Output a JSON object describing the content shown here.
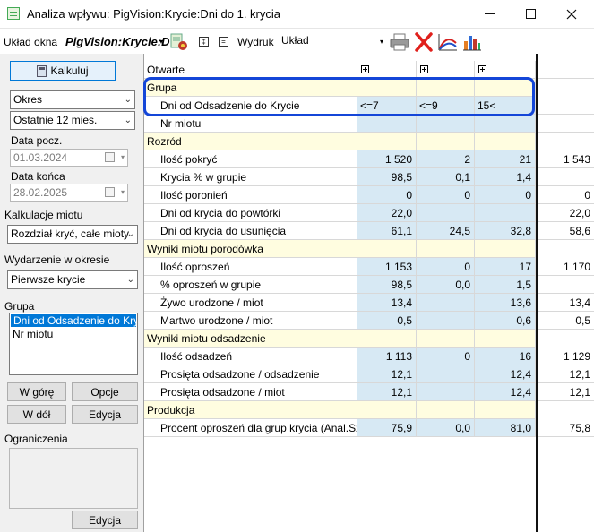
{
  "window": {
    "title": "Analiza wpływu: PigVision:Krycie:Dni do 1. krycia",
    "minimize": "–",
    "maximize": "□",
    "close": "✕"
  },
  "toolbar": {
    "layout_label": "Układ okna",
    "layout_name": "PigVision:Krycie:D",
    "layout_arrow": "▾",
    "expand_symbol": "‡",
    "collapse_symbol": "=",
    "print_label": "Wydruk",
    "print_combo_value": "Układ",
    "combo_arrow": "▾",
    "icons": [
      "layout-gear-icon",
      "printer-icon",
      "delete-x-icon",
      "chart-curve-icon",
      "bar-chart-icon"
    ]
  },
  "left_panel": {
    "calculate_button": "Kalkuluj",
    "period_type": "Okres",
    "period_value": "Ostatnie 12 mies.",
    "start_label": "Data pocz.",
    "start_date": "01.03.2024",
    "end_label": "Data końca",
    "end_date": "28.02.2025",
    "litter_calc_label": "Kalkulacje miotu",
    "litter_calc_value": "Rozdział kryć, całe mioty",
    "event_label": "Wydarzenie w okresie",
    "event_value": "Pierwsze krycie",
    "group_label": "Grupa",
    "group_items": [
      "Dni od Odsadzenie do Krycie",
      "Nr miotu"
    ],
    "btn_up": "W górę",
    "btn_options": "Opcje",
    "btn_down": "W dół",
    "btn_edit": "Edycja",
    "restrictions_label": "Ograniczenia",
    "btn_edit2": "Edycja",
    "arrow": "⌄"
  },
  "grid": {
    "header_label": "Otwarte",
    "header_icon": "expand-column-icon",
    "sections": [
      {
        "title": "Grupa",
        "rows": [
          {
            "label": "Dni od Odsadzenie do Krycie",
            "values": [
              "<=7",
              "<=9",
              "15<",
              ""
            ]
          },
          {
            "label": "Nr miotu",
            "values": [
              "",
              "",
              "",
              ""
            ]
          }
        ]
      },
      {
        "title": "Rozród",
        "rows": [
          {
            "label": "Ilość pokryć",
            "values": [
              "1 520",
              "2",
              "21",
              "1 543"
            ]
          },
          {
            "label": "Krycia % w grupie",
            "values": [
              "98,5",
              "0,1",
              "1,4",
              ""
            ]
          },
          {
            "label": "Ilość poronień",
            "values": [
              "0",
              "0",
              "0",
              "0"
            ]
          },
          {
            "label": "Dni od krycia do powtórki",
            "values": [
              "22,0",
              "",
              "",
              "22,0"
            ]
          },
          {
            "label": "Dni od krycia do usunięcia",
            "values": [
              "61,1",
              "24,5",
              "32,8",
              "58,6"
            ]
          }
        ]
      },
      {
        "title": "Wyniki miotu porodówka",
        "rows": [
          {
            "label": "Ilość oproszeń",
            "values": [
              "1 153",
              "0",
              "17",
              "1 170"
            ]
          },
          {
            "label": "% oproszeń w grupie",
            "values": [
              "98,5",
              "0,0",
              "1,5",
              ""
            ]
          },
          {
            "label": "Żywo urodzone / miot",
            "values": [
              "13,4",
              "",
              "13,6",
              "13,4"
            ]
          },
          {
            "label": "Martwo urodzone / miot",
            "values": [
              "0,5",
              "",
              "0,6",
              "0,5"
            ]
          }
        ]
      },
      {
        "title": "Wyniki miotu odsadzenie",
        "rows": [
          {
            "label": "Ilość odsadzeń",
            "values": [
              "1 113",
              "0",
              "16",
              "1 129"
            ]
          },
          {
            "label": "Prosięta odsadzone / odsadzenie",
            "values": [
              "12,1",
              "",
              "12,4",
              "12,1"
            ]
          },
          {
            "label": "Prosięta odsadzone / miot",
            "values": [
              "12,1",
              "",
              "12,4",
              "12,1"
            ]
          }
        ]
      },
      {
        "title": "Produkcja",
        "rows": [
          {
            "label": "Procent oproszeń dla grup krycia (Anal.Sz.)",
            "values": [
              "75,9",
              "0,0",
              "81,0",
              "75,8"
            ]
          }
        ]
      }
    ]
  }
}
